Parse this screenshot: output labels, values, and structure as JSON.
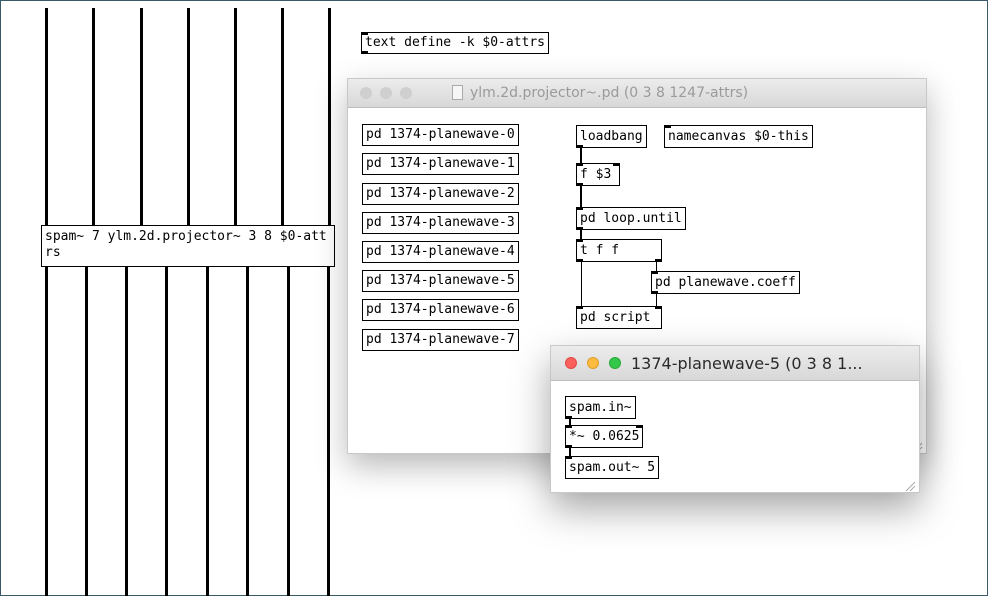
{
  "main_canvas": {
    "spam_object": "spam~ 7 ylm.2d.projector~ 3 8 $0-attrs",
    "text_define": "text define -k $0-attrs"
  },
  "projector_window": {
    "title": "ylm.2d.projector~.pd (0 3 8 1247-attrs)",
    "subpatches": [
      "pd 1374-planewave-0",
      "pd 1374-planewave-1",
      "pd 1374-planewave-2",
      "pd 1374-planewave-3",
      "pd 1374-planewave-4",
      "pd 1374-planewave-5",
      "pd 1374-planewave-6",
      "pd 1374-planewave-7"
    ],
    "loadbang": "loadbang",
    "namecanvas": "namecanvas $0-this",
    "float": "f $3",
    "loop_until": "pd loop.until",
    "trigger": "t f f",
    "planewave_coeff": "pd planewave.coeff",
    "script": "pd script"
  },
  "planewave_window": {
    "title": "1374-planewave-5 (0 3 8 1...",
    "spam_in": "spam.in~",
    "multiply": "*~ 0.0625",
    "spam_out": "spam.out~ 5"
  },
  "colors": {
    "close": "#fc605c",
    "minimize": "#fdbc40",
    "zoom": "#34c84a",
    "inactive": "#cfcfcf"
  }
}
